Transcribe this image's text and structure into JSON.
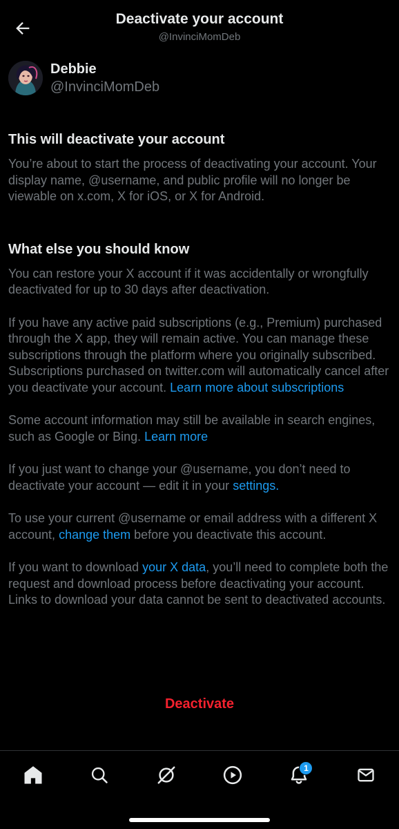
{
  "header": {
    "title": "Deactivate your account",
    "subtitle": "@InvinciMomDeb"
  },
  "profile": {
    "name": "Debbie",
    "handle": "@InvinciMomDeb"
  },
  "section1": {
    "title": "This will deactivate your account",
    "body": "You’re about to start the process of deactivating your account. Your display name, @username, and public profile will no longer be viewable on x.com, X for iOS, or X for Android."
  },
  "section2": {
    "title": "What else you should know",
    "p1": "You can restore your X account if it was accidentally or wrongfully deactivated for up to 30 days after deactivation.",
    "p2": "If you have any active paid subscriptions (e.g., Premium) purchased through the X app, they will remain active. You can manage these subscriptions through the platform where you originally subscribed. Subscriptions purchased on twitter.com will automatically cancel after you deactivate your account.",
    "p2_link": "Learn more about subscriptions",
    "p3": "Some account information may still be available in search engines, such as Google or Bing.",
    "p3_link": "Learn more",
    "p4_pre": "If you just want to change your @username, you don’t need to deactivate your account — edit it in your",
    "p4_link": "settings",
    "p4_post": ".",
    "p5_pre": "To use your current @username or email address with a different X account,",
    "p5_link": "change them",
    "p5_post": "before you deactivate this account.",
    "p6_pre": "If you want to download",
    "p6_link": "your X data",
    "p6_post": ", you’ll need to complete both the request and download process before deactivating your account. Links to download your data cannot be sent to deactivated accounts."
  },
  "action": {
    "deactivate_label": "Deactivate"
  },
  "nav": {
    "items": [
      {
        "icon": "home-icon"
      },
      {
        "icon": "search-icon"
      },
      {
        "icon": "grok-icon"
      },
      {
        "icon": "video-icon"
      },
      {
        "icon": "notifications-icon",
        "badge": "1"
      },
      {
        "icon": "messages-icon"
      }
    ]
  },
  "colors": {
    "background": "#000000",
    "text": "#e7e9ea",
    "secondary_text": "#71767b",
    "link": "#1d9bf0",
    "danger": "#f4212e"
  }
}
